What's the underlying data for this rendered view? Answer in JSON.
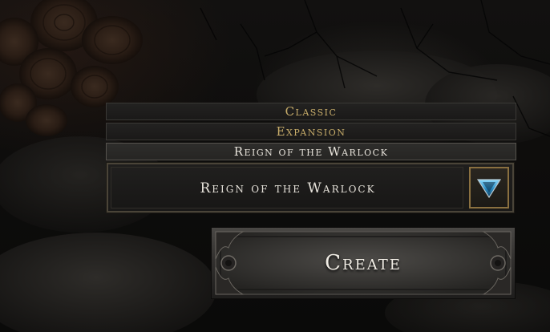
{
  "version_dropdown": {
    "options": [
      {
        "label": "Classic",
        "color": "#c8ad6a"
      },
      {
        "label": "Expansion",
        "color": "#c8ad6a"
      },
      {
        "label": "Reign of the Warlock",
        "color": "#e8e4dc",
        "selected": true
      }
    ],
    "selected_value": "Reign of the Warlock",
    "expanded": true,
    "arrow_icon": "triangle-down-gem-icon"
  },
  "create_button": {
    "label": "Create"
  },
  "colors": {
    "gold_text": "#c8ad6a",
    "white_text": "#e8e4dc",
    "frame_gold": "#8a7040",
    "gem_blue": "#3aa6d8"
  }
}
